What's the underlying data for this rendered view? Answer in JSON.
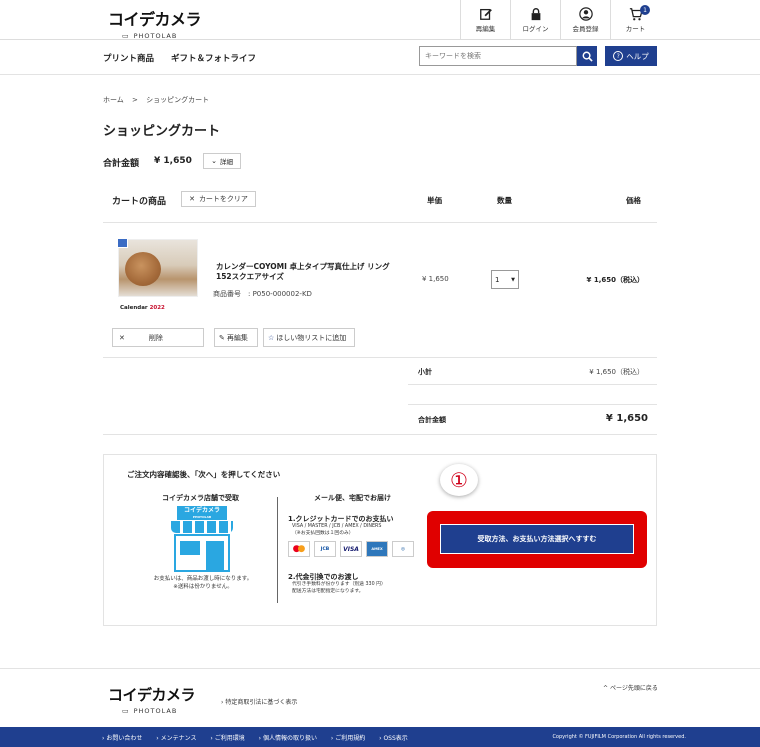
{
  "brand": {
    "name": "コイデカメラ",
    "sub": "PHOTOLAB"
  },
  "header_icons": [
    {
      "label": "再編集",
      "icon": "edit-icon"
    },
    {
      "label": "ログイン",
      "icon": "lock-icon"
    },
    {
      "label": "会員登録",
      "icon": "user-icon"
    },
    {
      "label": "カート",
      "icon": "cart-icon",
      "badge": "1"
    }
  ],
  "nav": {
    "items": [
      "プリント商品",
      "ギフト＆フォトライフ"
    ]
  },
  "search": {
    "placeholder": "キーワードを検索"
  },
  "help": {
    "label": "ヘルプ"
  },
  "breadcrumb": {
    "home": "ホーム",
    "sep": ">",
    "current": "ショッピングカート"
  },
  "page_title": "ショッピングカート",
  "summary": {
    "total_label": "合計金額",
    "total_value": "¥ 1,650",
    "detail_label": "詳細"
  },
  "cart": {
    "heading": "カートの商品",
    "clear_label": "カートをクリア",
    "columns": {
      "unit_price": "単価",
      "quantity": "数量",
      "price": "価格"
    },
    "items": [
      {
        "name": "カレンダーCOYOMI 卓上タイプ写真仕上げ リング 152スクエアサイズ",
        "code": "商品番号　: P050-000002-KD",
        "calendar_label": "Calendar",
        "calendar_year": "2022",
        "unit_price": "¥ 1,650",
        "quantity": "1",
        "price": "¥ 1,650（税込）",
        "delete_label": "削除",
        "reedit_label": "再編集",
        "wishlist_label": "ほしい物リストに追加"
      }
    ],
    "subtotal_label": "小計",
    "subtotal_value": "¥ 1,650（税込）",
    "grand_total_label": "合計金額",
    "grand_total_value": "¥ 1,650"
  },
  "checkout": {
    "title": "ご注文内容確認後、「次へ」を押してください",
    "store_heading": "コイデカメラ店舗で受取",
    "store_sign": "コイデカメラ",
    "store_sign_sub": "PHOTOLAB",
    "store_note_1": "お支払いは、商品お渡し時になります。",
    "store_note_2": "※送料は份かりません。",
    "delivery_heading": "メール便、宅配でお届け",
    "card_heading": "1.クレジットカードでのお支払い",
    "card_sub_1": "VISA / MASTER / JCB / AMEX / DINERS",
    "card_sub_2": "（※お支払回数は１回のみ）",
    "card_brands": [
      "mastercard",
      "JCB",
      "VISA",
      "AMEX",
      "Diners"
    ],
    "cod_heading": "2.代金引換でのお渡し",
    "cod_sub_1": "代引き手数料が份かります（別途 330 円）",
    "cod_sub_2": "配送方法は宅配指定になります。",
    "step_marker": "①",
    "next_label": "受取方法、お支払い方法選択へすすむ"
  },
  "footer": {
    "law_link": "特定商取引法に基づく表示",
    "back_to_top": "ページ先頭に戻る",
    "links": [
      "お問い合わせ",
      "メンテナンス",
      "ご利用環境",
      "個人情報の取り扱い",
      "ご利用規約",
      "OSS表示"
    ],
    "copyright": "Copyright © FUJIFILM Corporation All rights reserved."
  },
  "colors": {
    "brand_blue": "#1f3f8f",
    "highlight_red": "#e00000"
  }
}
